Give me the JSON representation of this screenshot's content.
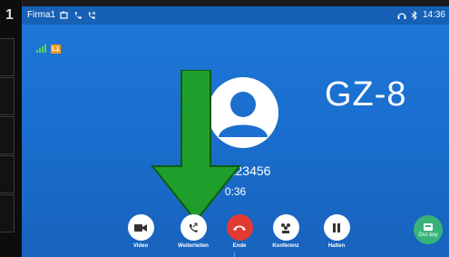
{
  "bezel": {
    "number": "1"
  },
  "statusbar": {
    "account": "Firma1",
    "time": "14:36"
  },
  "line": {
    "badge": "L1"
  },
  "call": {
    "number": "0176123456",
    "duration": "0:36"
  },
  "overlay": {
    "label": "GZ-8"
  },
  "actions": [
    {
      "label": "Video",
      "icon": "video-icon"
    },
    {
      "label": "Weiterleiten",
      "icon": "call-forward-icon"
    },
    {
      "label": "Ende",
      "icon": "end-call-icon"
    },
    {
      "label": "Konferenz",
      "icon": "conference-icon"
    },
    {
      "label": "Halten",
      "icon": "pause-icon"
    }
  ],
  "dsskey": {
    "label": "Dss key",
    "icon": "dss-key-icon"
  },
  "colors": {
    "screen": "#1e78d6",
    "end_button": "#e23a32",
    "arrow": "#1f9e2c",
    "dss_key": "#37b37a"
  }
}
